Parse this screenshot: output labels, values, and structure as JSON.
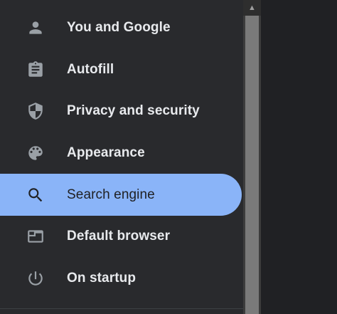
{
  "sidebar": {
    "items": [
      {
        "label": "You and Google",
        "icon": "person-icon",
        "active": false
      },
      {
        "label": "Autofill",
        "icon": "clipboard-icon",
        "active": false
      },
      {
        "label": "Privacy and security",
        "icon": "shield-icon",
        "active": false
      },
      {
        "label": "Appearance",
        "icon": "palette-icon",
        "active": false
      },
      {
        "label": "Search engine",
        "icon": "search-icon",
        "active": true
      },
      {
        "label": "Default browser",
        "icon": "browser-window-icon",
        "active": false
      },
      {
        "label": "On startup",
        "icon": "power-icon",
        "active": false
      }
    ]
  },
  "scrollbar": {
    "up_arrow": "▲"
  },
  "colors": {
    "sidebar_bg": "#292a2d",
    "active_bg": "#8ab4f8",
    "text": "#e8eaed",
    "icon": "#9aa0a6"
  }
}
